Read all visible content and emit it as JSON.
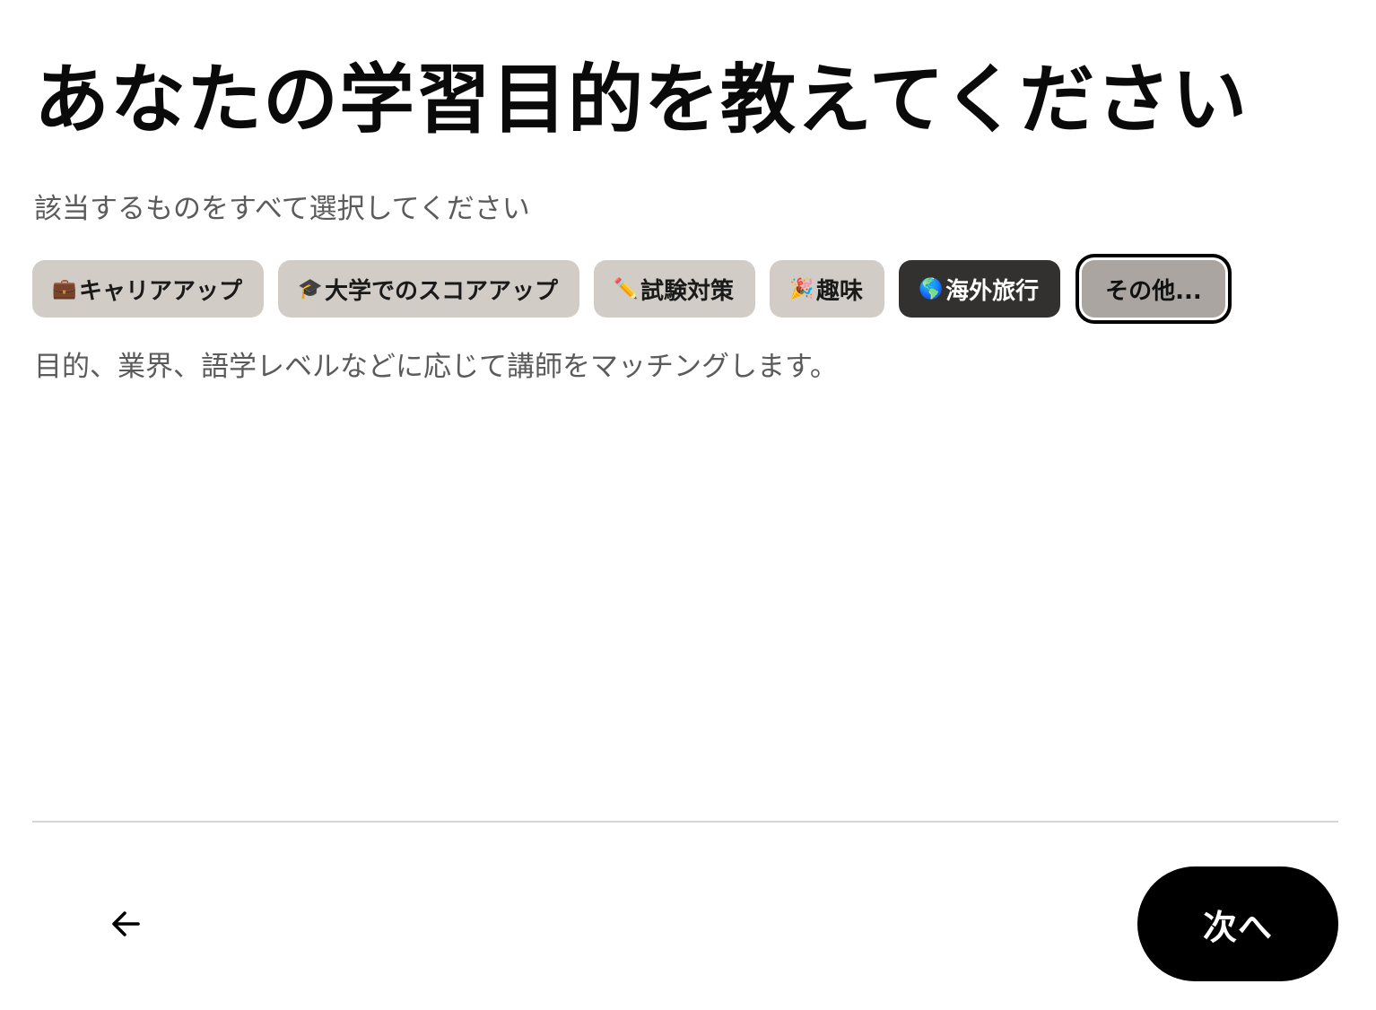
{
  "header": {
    "title": "あなたの学習目的を教えてください",
    "subtitle": "該当するものをすべて選択してください"
  },
  "options": [
    {
      "emoji": "💼",
      "label": "キャリアアップ",
      "selected": false
    },
    {
      "emoji": "🎓",
      "label": "大学でのスコアアップ",
      "selected": false
    },
    {
      "emoji": "✏️",
      "label": "試験対策",
      "selected": false
    },
    {
      "emoji": "🎉",
      "label": "趣味",
      "selected": false
    },
    {
      "emoji": "🌎",
      "label": "海外旅行",
      "selected": true
    },
    {
      "emoji": "",
      "label": "その他...",
      "selected": false,
      "focused": true
    }
  ],
  "helper_text": "目的、業界、語学レベルなどに応じて講師をマッチングします。",
  "footer": {
    "back_icon": "arrow-left-icon",
    "next_label": "次へ"
  },
  "colors": {
    "chip_bg": "#d2ccc7",
    "chip_selected_bg": "#333130",
    "chip_focused_bg": "#aaa5a0",
    "primary_button": "#000000",
    "secondary_text": "#5b5b5b",
    "divider": "#d6d6d6"
  }
}
